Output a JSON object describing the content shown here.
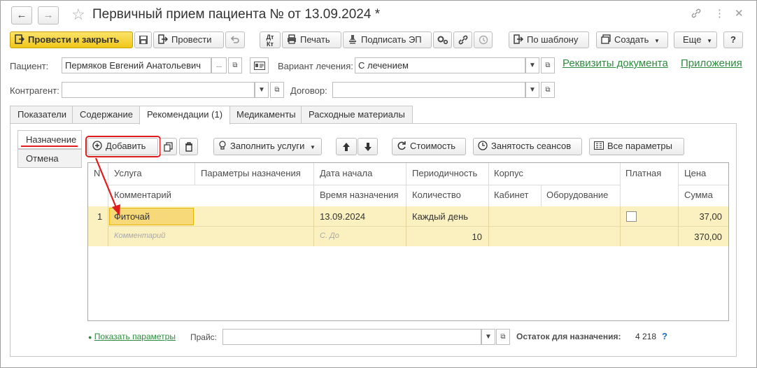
{
  "window": {
    "title": "Первичный прием пациента №  от 13.09.2024 *",
    "back_icon": "←",
    "forward_icon": "→",
    "star_icon": "☆",
    "link_icon": "🔗",
    "more_icon": "⋮",
    "close_icon": "✕"
  },
  "toolbar": {
    "post_close": "Провести и закрыть",
    "post": "Провести",
    "print": "Печать",
    "sign": "Подписать ЭП",
    "by_template": "По шаблону",
    "create": "Создать",
    "more": "Еще",
    "help": "?"
  },
  "form": {
    "patient_label": "Пациент:",
    "patient_value": "Пермяков Евгений Анатольевич",
    "variant_label": "Вариант лечения:",
    "variant_value": "С лечением",
    "counterparty_label": "Контрагент:",
    "counterparty_value": "",
    "contract_label": "Договор:",
    "contract_value": "",
    "requisites_link": "Реквизиты документа",
    "attachments_link": "Приложения",
    "ellipsis": "..."
  },
  "tabs": [
    {
      "label": "Показатели"
    },
    {
      "label": "Содержание"
    },
    {
      "label": "Рекомендации (1)",
      "active": true
    },
    {
      "label": "Медикаменты"
    },
    {
      "label": "Расходные материалы"
    }
  ],
  "side": {
    "assign": "Назначение",
    "cancel": "Отмена"
  },
  "panel_toolbar": {
    "add": "Добавить",
    "fill_services": "Заполнить услуги",
    "cost": "Стоимость",
    "sessions": "Занятость сеансов",
    "all_params": "Все параметры"
  },
  "grid": {
    "headers": {
      "n": "N",
      "service": "Услуга",
      "params": "Параметры назначения",
      "start_date": "Дата начала",
      "periodicity": "Периодичность",
      "building": "Корпус",
      "paid": "Платная",
      "price": "Цена",
      "comment": "Комментарий",
      "time": "Время назначения",
      "quantity": "Количество",
      "cabinet": "Кабинет",
      "equipment": "Оборудование",
      "sum": "Сумма"
    },
    "rows": [
      {
        "n": "1",
        "service": "Фиточай",
        "params": "",
        "start_date": "13.09.2024",
        "periodicity": "Каждый день",
        "building": "",
        "paid": false,
        "price": "37,00",
        "comment_placeholder": "Комментарий",
        "time_placeholder": "С. До",
        "quantity": "10",
        "cabinet": "",
        "equipment": "",
        "sum": "370,00"
      }
    ]
  },
  "footer": {
    "show_params": "Показать параметры",
    "price_label": "Прайс:",
    "price_value": "",
    "remaining_label": "Остаток для назначения:",
    "remaining_value": "4 218",
    "help": "?"
  },
  "colors": {
    "accent_yellow": "#f0c619",
    "link_green": "#2e8b3d",
    "annotation_red": "#e01b1b",
    "row_highlight": "#fbf1c0"
  }
}
